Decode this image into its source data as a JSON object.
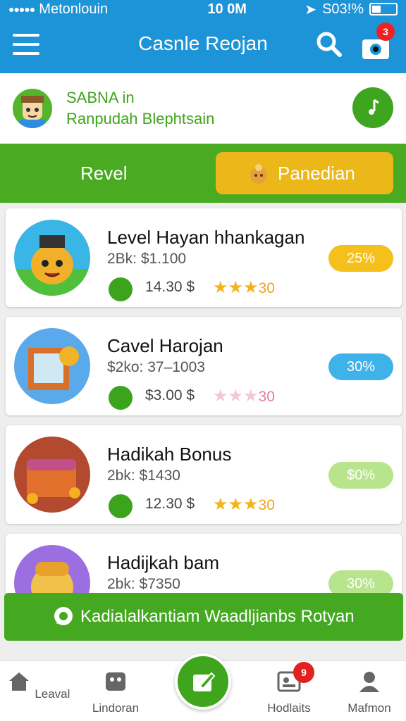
{
  "status_bar": {
    "carrier": "Metonlouin",
    "time": "10 0M",
    "battery": "S03!%"
  },
  "app_bar": {
    "title": "Casnle Reojan",
    "notification_count": "3"
  },
  "profile": {
    "line1": "SABNA in",
    "line2": "Ranpudah Blephtsain"
  },
  "tabs": {
    "left_label": "Revel",
    "right_label": "Panedian"
  },
  "cards": [
    {
      "title": "Level Hayan hhankagan",
      "subtitle": "2Bk: $1.100",
      "price": "14.30 $",
      "rating": "30",
      "badge": "25%",
      "badge_color": "#f5bf1c",
      "stars_filled": 3
    },
    {
      "title": "Cavel Harojan",
      "subtitle": "$2ko: 37–1003",
      "price": "$3.00 $",
      "rating": "30",
      "badge": "30%",
      "badge_color": "#3fb2ea",
      "stars_filled": 0
    },
    {
      "title": "Hadikah Bonus",
      "subtitle": "2bk: $1430",
      "price": "12.30 $",
      "rating": "30",
      "badge": "$0%",
      "badge_color": "#b7e48c",
      "stars_filled": 3
    },
    {
      "title": "Hadijkah bam",
      "subtitle": "2bk: $7350",
      "badge": "30%",
      "badge_color": "#b7e48c"
    }
  ],
  "banner": {
    "text": "Kadialalkantiam Waadljianbs Rotyan"
  },
  "bottom_nav": {
    "items": [
      "Leaval",
      "Lindoran",
      "Hodlaits",
      "Mafmon"
    ],
    "badge": "9"
  },
  "colors": {
    "primary_blue": "#1d93d8",
    "primary_green": "#4aab22",
    "accent_yellow": "#ecb718"
  }
}
